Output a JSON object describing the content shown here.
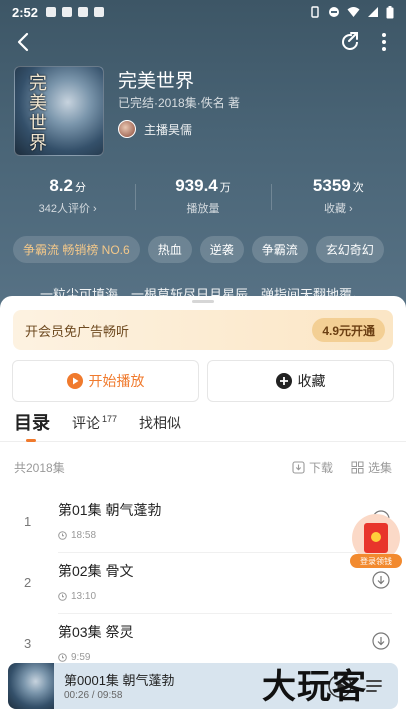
{
  "status_bar": {
    "time": "2:52"
  },
  "book": {
    "title": "完美世界",
    "meta": "已完结·2018集·佚名 著",
    "narrator": "主播昊儒",
    "cover_art_text": "完美世界"
  },
  "stats": [
    {
      "value": "8.2",
      "unit": "分",
      "label": "342人评价 ›"
    },
    {
      "value": "939.4",
      "unit": "万",
      "label": "播放量"
    },
    {
      "value": "5359",
      "unit": "次",
      "label": "收藏 ›"
    }
  ],
  "tags": [
    "争霸流 畅销榜 NO.6",
    "热血",
    "逆袭",
    "争霸流",
    "玄幻奇幻"
  ],
  "intro": "一粒尘可填海，一根草斩尽日月星辰，弹指间天翻地覆。",
  "vip": {
    "text": "开会员免广告畅听",
    "button": "4.9元开通"
  },
  "actions": {
    "play": "开始播放",
    "favorite": "收藏"
  },
  "tabs": [
    {
      "label": "目录",
      "count": ""
    },
    {
      "label": "评论",
      "count": "177"
    },
    {
      "label": "找相似",
      "count": ""
    }
  ],
  "list_header": {
    "total": "共2018集",
    "download": "下载",
    "select": "选集"
  },
  "episodes": [
    {
      "num": "1",
      "title": "第01集 朝气蓬勃",
      "duration": "18:58"
    },
    {
      "num": "2",
      "title": "第02集 骨文",
      "duration": "13:10"
    },
    {
      "num": "3",
      "title": "第03集 祭灵",
      "duration": "9:59"
    }
  ],
  "red_packet": {
    "label": "登录领钱"
  },
  "player": {
    "title": "第0001集 朝气蓬勃",
    "time": "00:26 / 09:58"
  },
  "watermark": "大玩客",
  "colors": {
    "accent": "#f07a2d",
    "header_bg": "#4a6577",
    "vip_bg": "#fbe6c5"
  }
}
